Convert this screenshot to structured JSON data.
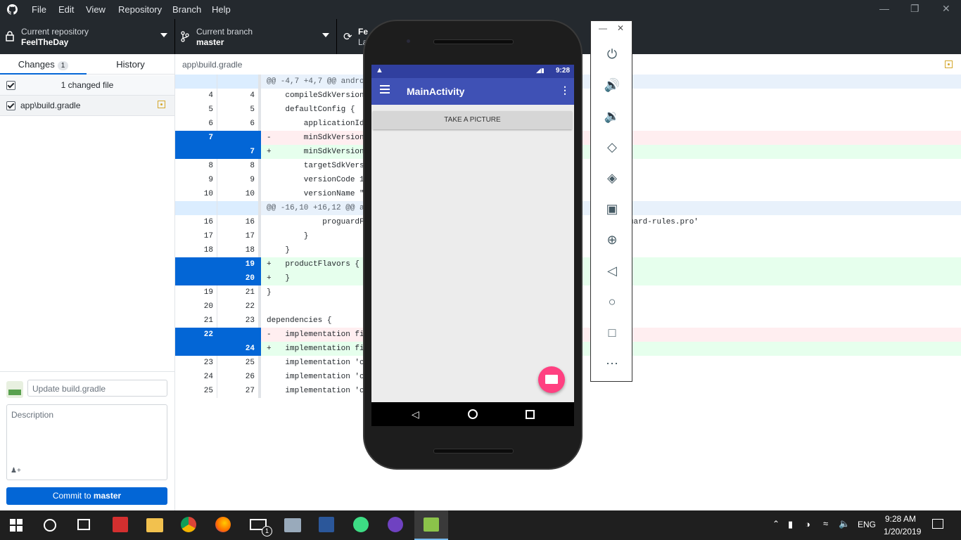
{
  "titlebar": {
    "menu": [
      "File",
      "Edit",
      "View",
      "Repository",
      "Branch",
      "Help"
    ],
    "window_controls": [
      "minimize-icon",
      "restore-icon",
      "close-icon"
    ]
  },
  "toolbar": {
    "repo_label": "Current repository",
    "repo_value": "FeelTheDay",
    "branch_label": "Current branch",
    "branch_value": "master",
    "fetch_label": "Fe",
    "fetch_sub": "La"
  },
  "left_pane": {
    "tab_changes": "Changes",
    "changes_count": "1",
    "tab_history": "History",
    "changed_files_label": "1 changed file",
    "files": [
      {
        "path": "app\\build.gradle",
        "status_color": "#d4a72c"
      }
    ]
  },
  "commit": {
    "summary_placeholder": "Update build.gradle",
    "description_placeholder": "Description",
    "coauthor_icon": "add-coauthor-icon",
    "button_prefix": "Commit to ",
    "button_branch": "master"
  },
  "diff": {
    "file_path": "app\\build.gradle",
    "rows": [
      {
        "type": "hunk",
        "old": "",
        "new": "",
        "code": "@@ -4,7 +4,7 @@ android"
      },
      {
        "type": "ctx",
        "old": "4",
        "new": "4",
        "code": "    compileSdkVersion"
      },
      {
        "type": "ctx",
        "old": "5",
        "new": "5",
        "code": "    defaultConfig {"
      },
      {
        "type": "ctx",
        "old": "6",
        "new": "6",
        "code": "        applicationId"
      },
      {
        "type": "del",
        "old": "7",
        "new": "",
        "code": "-       minSdkVersion"
      },
      {
        "type": "add",
        "old": "",
        "new": "7",
        "code": "+       minSdkVersion"
      },
      {
        "type": "ctx",
        "old": "8",
        "new": "8",
        "code": "        targetSdkVersi"
      },
      {
        "type": "ctx",
        "old": "9",
        "new": "9",
        "code": "        versionCode 1"
      },
      {
        "type": "ctx",
        "old": "10",
        "new": "10",
        "code": "        versionName \"1"
      },
      {
        "type": "hunk",
        "old": "",
        "new": "",
        "code": "@@ -16,10 +16,12 @@ and"
      },
      {
        "type": "ctx",
        "old": "16",
        "new": "16",
        "code": "            proguardFi                                                   'proguard-rules.pro'"
      },
      {
        "type": "ctx",
        "old": "17",
        "new": "17",
        "code": "        }"
      },
      {
        "type": "ctx",
        "old": "18",
        "new": "18",
        "code": "    }"
      },
      {
        "type": "add",
        "old": "",
        "new": "19",
        "code": "+   productFlavors {"
      },
      {
        "type": "add",
        "old": "",
        "new": "20",
        "code": "+   }"
      },
      {
        "type": "ctx",
        "old": "19",
        "new": "21",
        "code": "}"
      },
      {
        "type": "ctx",
        "old": "20",
        "new": "22",
        "code": ""
      },
      {
        "type": "ctx",
        "old": "21",
        "new": "23",
        "code": "dependencies {"
      },
      {
        "type": "del",
        "old": "22",
        "new": "",
        "code": "-   implementation fil"
      },
      {
        "type": "add",
        "old": "",
        "new": "24",
        "code": "+   implementation fil"
      },
      {
        "type": "ctx",
        "old": "23",
        "new": "25",
        "code": "    implementation 'co"
      },
      {
        "type": "ctx",
        "old": "24",
        "new": "26",
        "code": "    implementation 'co"
      },
      {
        "type": "ctx",
        "old": "25",
        "new": "27",
        "code": "    implementation 'co"
      }
    ]
  },
  "phone": {
    "time": "9:28",
    "app_title": "MainActivity",
    "button_label": "TAKE A PICTURE",
    "primary_color": "#3f51b5",
    "fab_color": "#ff4081"
  },
  "emulator_tools": [
    "power-icon",
    "volume-up-icon",
    "volume-down-icon",
    "rotate-left-icon",
    "rotate-right-icon",
    "screenshot-icon",
    "zoom-icon",
    "back-icon",
    "home-icon",
    "overview-icon",
    "more-icon"
  ],
  "taskbar": {
    "language": "ENG",
    "time": "9:28 AM",
    "date": "1/20/2019",
    "mail_badge": "1"
  }
}
